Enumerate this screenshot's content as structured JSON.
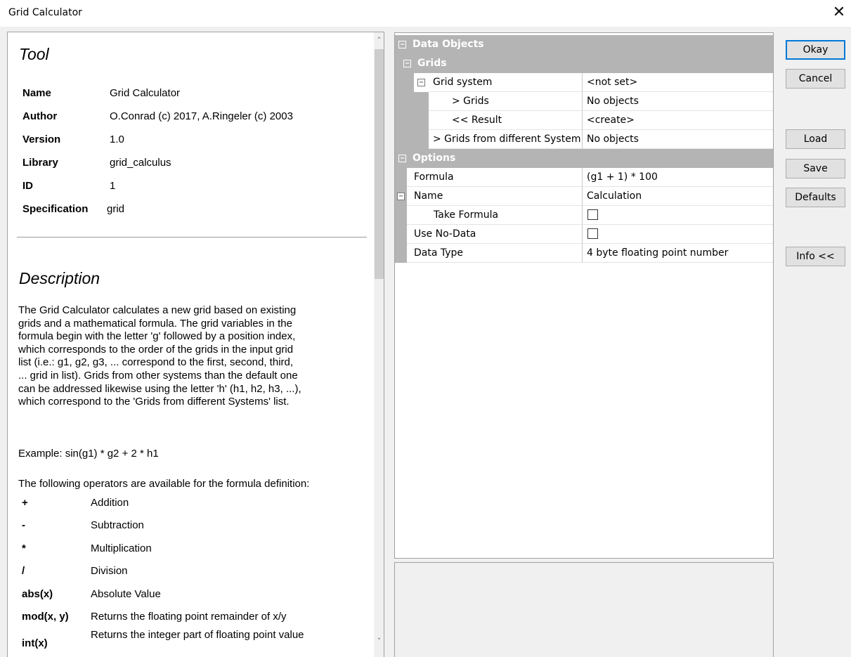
{
  "window": {
    "title": "Grid Calculator",
    "close_glyph": "✕"
  },
  "tool": {
    "heading": "Tool",
    "fields": [
      {
        "label": "Name",
        "value": "Grid Calculator"
      },
      {
        "label": "Author",
        "value": "O.Conrad (c) 2017, A.Ringeler (c) 2003"
      },
      {
        "label": "Version",
        "value": "1.0"
      },
      {
        "label": "Library",
        "value": "grid_calculus"
      },
      {
        "label": "ID",
        "value": "1"
      },
      {
        "label": "Specification",
        "value": "grid"
      }
    ]
  },
  "description": {
    "heading": "Description",
    "lines": [
      "The Grid Calculator calculates a new grid based on existing",
      "grids and a mathematical formula. The grid variables in the",
      "formula begin with the letter 'g' followed by a position index,",
      "which corresponds to the order of the grids in the input grid",
      "list (i.e.: g1, g2, g3, ... correspond to the first, second, third,",
      "... grid in list). Grids from other systems than the default one",
      "can be addressed likewise using the letter 'h' (h1, h2, h3, ...),",
      "which correspond to the 'Grids from different Systems' list."
    ],
    "example": "Example: sin(g1) * g2 + 2 * h1",
    "ops_intro": "The following operators are available for the formula definition:",
    "operators": [
      {
        "symbol": "+",
        "text": "Addition"
      },
      {
        "symbol": "-",
        "text": "Subtraction"
      },
      {
        "symbol": "*",
        "text": "Multiplication"
      },
      {
        "symbol": "/",
        "text": "Division"
      },
      {
        "symbol": "abs(x)",
        "text": "Absolute Value"
      },
      {
        "symbol": "mod(x, y)",
        "text": "Returns the floating point remainder of x/y"
      },
      {
        "symbol": "int(x)",
        "text": "Returns the integer part of floating point value"
      }
    ]
  },
  "scrollbar": {
    "up_glyph": "˄",
    "down_glyph": "˅"
  },
  "properties": {
    "collapse_glyph": "−",
    "data_objects": "Data Objects",
    "grids_cat": "Grids",
    "grid_system": {
      "name": "Grid system",
      "value": "<not set>"
    },
    "grids": {
      "name": "> Grids",
      "value": "No objects"
    },
    "result": {
      "name": "<< Result",
      "value": "<create>"
    },
    "grids_other": {
      "name": "> Grids from different System",
      "value": "No objects"
    },
    "options": "Options",
    "formula": {
      "name": "Formula",
      "value": "(g1 + 1) * 100"
    },
    "name": {
      "name": "Name",
      "value": "Calculation"
    },
    "take_formula": {
      "name": "Take Formula",
      "checked": false
    },
    "use_nodata": {
      "name": "Use No-Data",
      "checked": false
    },
    "data_type": {
      "name": "Data Type",
      "value": "4 byte floating point number"
    }
  },
  "buttons": {
    "okay": "Okay",
    "cancel": "Cancel",
    "load": "Load",
    "save": "Save",
    "defaults": "Defaults",
    "info": "Info <<"
  }
}
